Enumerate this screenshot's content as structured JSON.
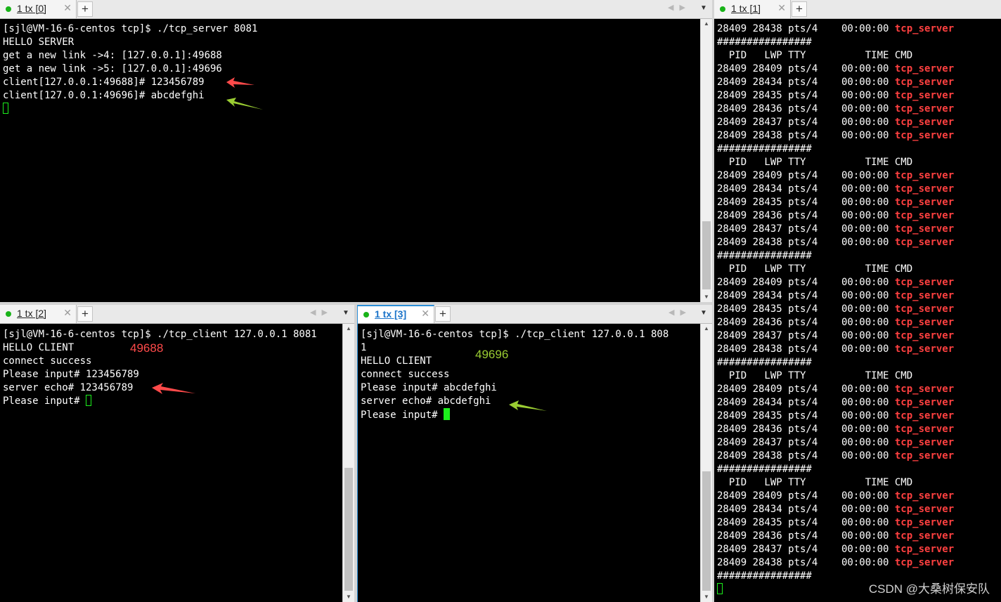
{
  "colors": {
    "red_annotation": "#ff4a4a",
    "green_annotation": "#9acd32",
    "cursor": "#1cf01c",
    "tab_active": "#2b8fd8"
  },
  "panes": {
    "tl": {
      "tab_label": "1 tx [0]",
      "lines": [
        "[sjl@VM-16-6-centos tcp]$ ./tcp_server 8081",
        "HELLO SERVER",
        "get a new link ->4: [127.0.0.1]:49688",
        "get a new link ->5: [127.0.0.1]:49696",
        "client[127.0.0.1:49688]# 123456789",
        "client[127.0.0.1:49696]# abcdefghi"
      ]
    },
    "bl": {
      "tab_label": "1 tx [2]",
      "lines": [
        "[sjl@VM-16-6-centos tcp]$ ./tcp_client 127.0.0.1 8081",
        "HELLO CLIENT",
        "connect success",
        "Please input# 123456789",
        "server echo# 123456789"
      ],
      "prompt": "Please input# ",
      "annotation": "49688"
    },
    "bm": {
      "tab_label": "1 tx [3]",
      "lines": [
        "[sjl@VM-16-6-centos tcp]$ ./tcp_client 127.0.0.1 808",
        "1",
        "HELLO CLIENT",
        "connect success",
        "Please input# abcdefghi",
        "server echo# abcdefghi"
      ],
      "prompt": "Please input# ",
      "annotation": "49696"
    },
    "right": {
      "tab_label": "1 tx [1]",
      "top_row": "28409 28438 pts/4    00:00:00 ",
      "separator": "################",
      "header": "  PID   LWP TTY          TIME CMD",
      "rows": [
        "28409 28409 pts/4    00:00:00 ",
        "28409 28434 pts/4    00:00:00 ",
        "28409 28435 pts/4    00:00:00 ",
        "28409 28436 pts/4    00:00:00 ",
        "28409 28437 pts/4    00:00:00 ",
        "28409 28438 pts/4    00:00:00 "
      ],
      "cmd": "tcp_server"
    }
  },
  "watermark": "CSDN @大桑树保安队"
}
